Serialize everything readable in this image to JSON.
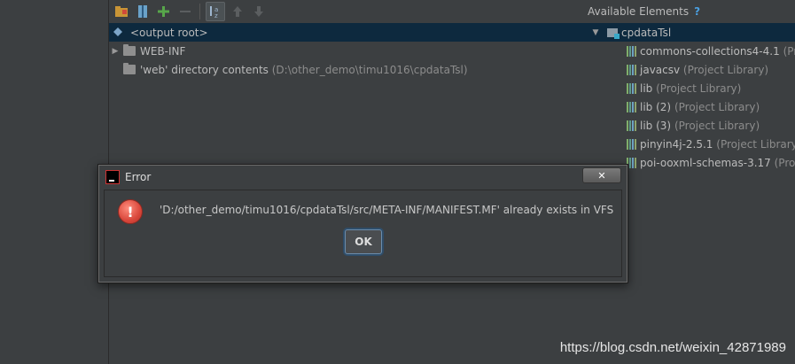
{
  "left_tree": {
    "root_label": "<output root>",
    "items": [
      {
        "label": "WEB-INF",
        "detail": ""
      },
      {
        "label": "'web' directory contents",
        "detail": "(D:\\other_demo\\timu1016\\cpdataTsl)"
      }
    ]
  },
  "right_panel": {
    "header": "Available Elements",
    "help_glyph": "?",
    "module": "cpdataTsl",
    "libraries": [
      {
        "name": "commons-collections4-4.1",
        "detail": "(Pro"
      },
      {
        "name": "javacsv",
        "detail": "(Project Library)"
      },
      {
        "name": "lib",
        "detail": "(Project Library)"
      },
      {
        "name": "lib (2)",
        "detail": "(Project Library)"
      },
      {
        "name": "lib (3)",
        "detail": "(Project Library)"
      },
      {
        "name": "pinyin4j-2.5.1",
        "detail": "(Project Library)"
      },
      {
        "name": "poi-ooxml-schemas-3.17",
        "detail": "(Pro"
      }
    ]
  },
  "dialog": {
    "title": "Error",
    "close_glyph": "✕",
    "icon_glyph": "!",
    "message": "'D:/other_demo/timu1016/cpdataTsl/src/META-INF/MANIFEST.MF' already exists in VFS",
    "ok_label": "OK"
  },
  "watermark": "https://blog.csdn.net/weixin_42871989",
  "colors": {
    "background": "#3c3f41",
    "selection": "#0d293e",
    "error": "#d9473b",
    "accent": "#4a9fe0"
  }
}
